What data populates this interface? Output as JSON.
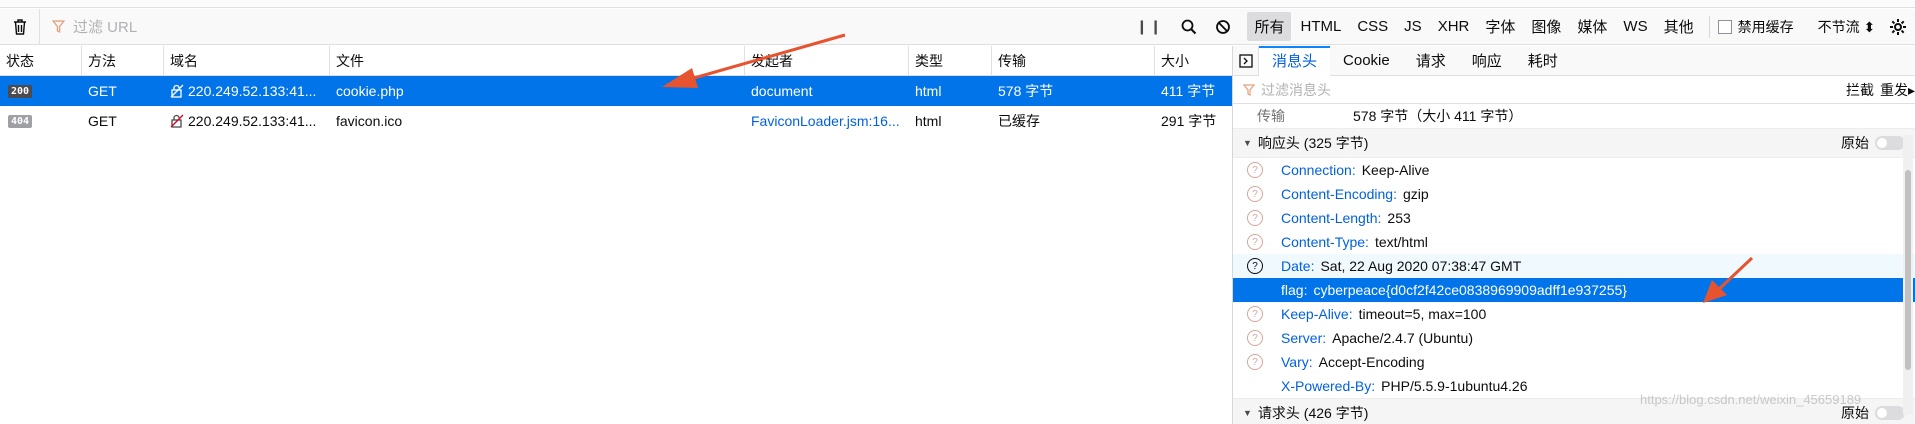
{
  "toolbar": {
    "filter_placeholder": "过滤 URL",
    "types": [
      "所有",
      "HTML",
      "CSS",
      "JS",
      "XHR",
      "字体",
      "图像",
      "媒体",
      "WS",
      "其他"
    ],
    "disable_cache": "禁用缓存",
    "throttle": "不节流 ⬍"
  },
  "columns": [
    "状态",
    "方法",
    "域名",
    "文件",
    "发起者",
    "类型",
    "传输",
    "大小"
  ],
  "requests": [
    {
      "status": "200",
      "method": "GET",
      "domain": "220.249.52.133:41...",
      "file": "cookie.php",
      "initiator": "document",
      "type": "html",
      "transferred": "578 字节",
      "size": "411 字节"
    },
    {
      "status": "404",
      "method": "GET",
      "domain": "220.249.52.133:41...",
      "file": "favicon.ico",
      "initiator": "FaviconLoader.jsm:16...",
      "type": "html",
      "transferred": "已缓存",
      "size": "291 字节"
    }
  ],
  "panel": {
    "tabs": [
      "消息头",
      "Cookie",
      "请求",
      "响应",
      "耗时"
    ],
    "filter_placeholder": "过滤消息头",
    "block": "拦截",
    "resend": "重发▸",
    "transfer_label": "传输",
    "transfer_value": "578 字节（大小 411 字节）",
    "response_section": "响应头 (325 字节)",
    "raw_label": "原始",
    "request_section": "请求头 (426 字节)",
    "response_headers": [
      {
        "name": "Connection:",
        "value": "Keep-Alive"
      },
      {
        "name": "Content-Encoding:",
        "value": "gzip"
      },
      {
        "name": "Content-Length:",
        "value": "253"
      },
      {
        "name": "Content-Type:",
        "value": "text/html"
      },
      {
        "name": "Date:",
        "value": "Sat, 22 Aug 2020 07:38:47 GMT"
      },
      {
        "name": "flag:",
        "value": "cyberpeace{d0cf2f42ce0838969909adff1e937255}"
      },
      {
        "name": "Keep-Alive:",
        "value": "timeout=5, max=100"
      },
      {
        "name": "Server:",
        "value": "Apache/2.4.7 (Ubuntu)"
      },
      {
        "name": "Vary:",
        "value": "Accept-Encoding"
      },
      {
        "name": "X-Powered-By:",
        "value": "PHP/5.5.9-1ubuntu4.26"
      }
    ]
  },
  "watermark": "https://blog.csdn.net/weixin_45659189",
  "colors": {
    "accent": "#0074e8",
    "arrow": "#e8532f"
  }
}
